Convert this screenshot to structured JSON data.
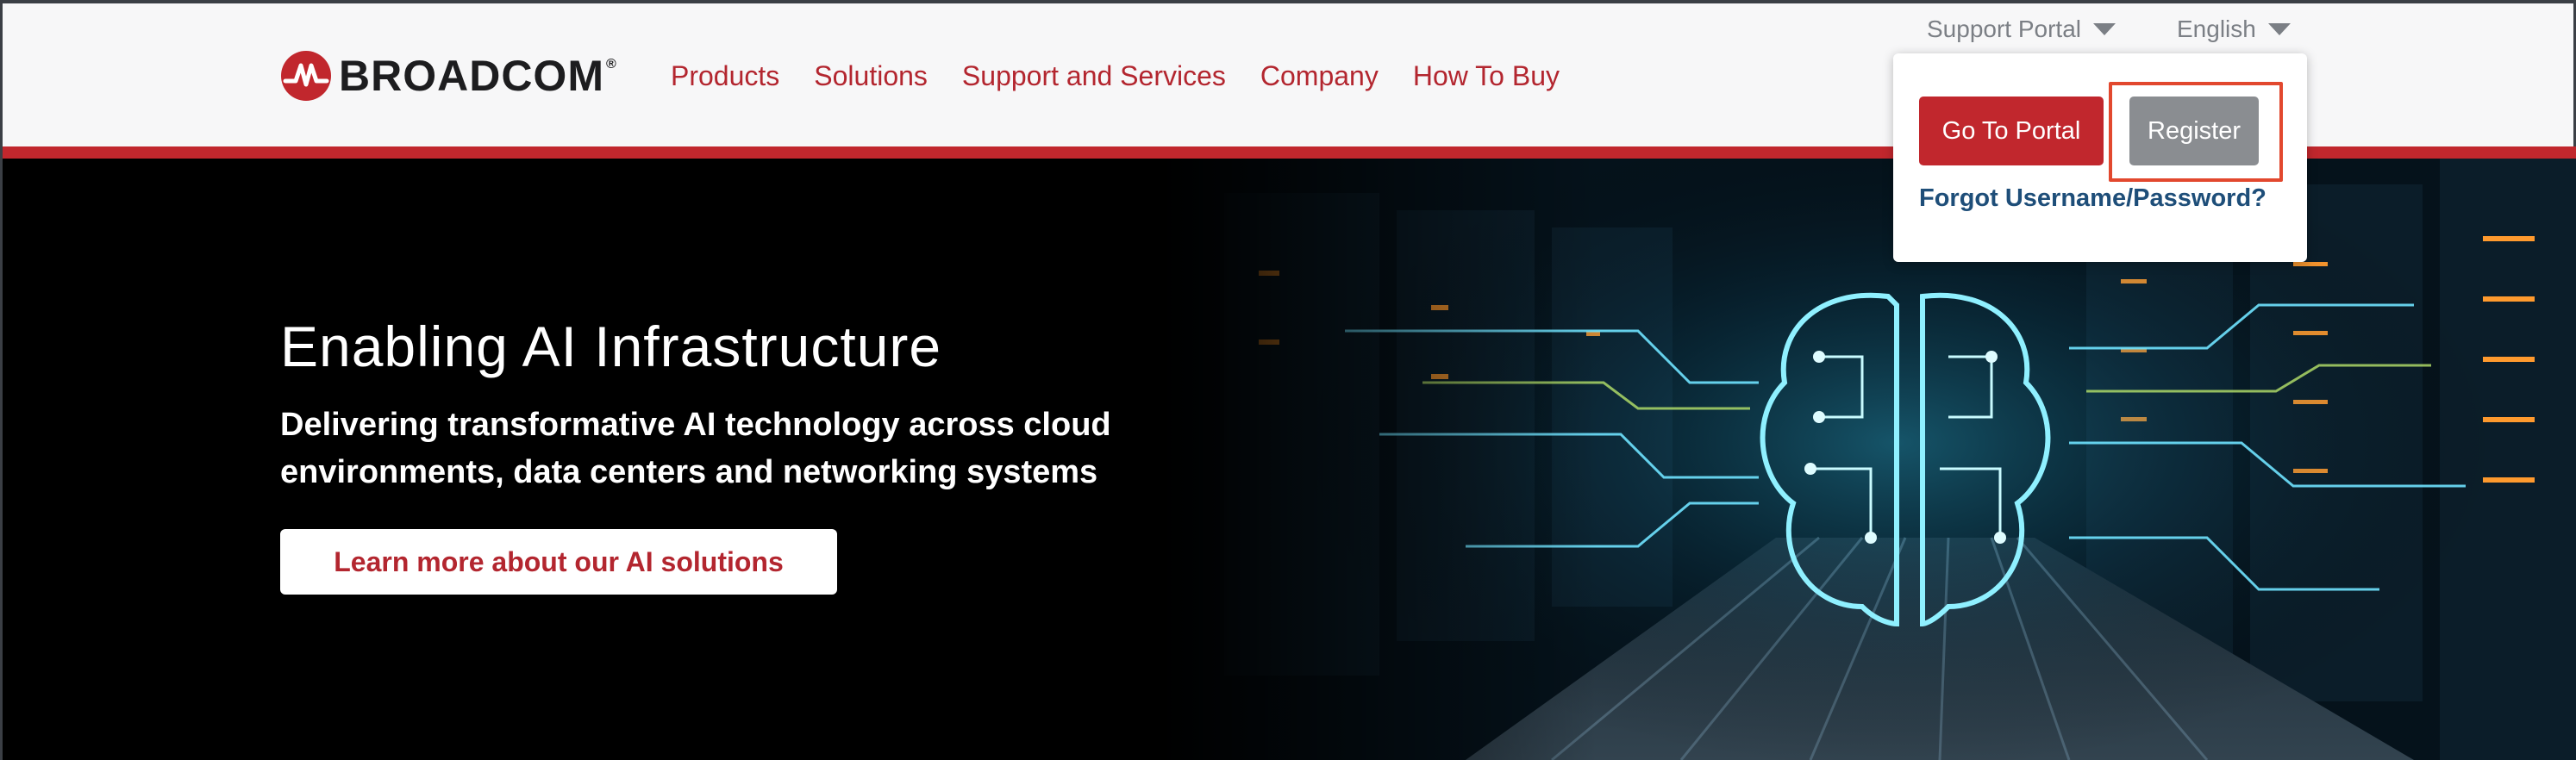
{
  "header": {
    "brand": "BROADCOM",
    "brand_mark": "®",
    "nav": [
      "Products",
      "Solutions",
      "Support and Services",
      "Company",
      "How To Buy"
    ],
    "support_portal_label": "Support Portal",
    "language_label": "English",
    "accent_color": "#c1272d"
  },
  "portal_dropdown": {
    "go_to_portal": "Go To Portal",
    "register": "Register",
    "forgot": "Forgot Username/Password?"
  },
  "hero": {
    "title": "Enabling AI Infrastructure",
    "subtitle_line1": "Delivering transformative AI technology across cloud",
    "subtitle_line2": "environments, data centers and networking systems",
    "cta": "Learn more about our AI solutions"
  },
  "icons": {
    "logo": "broadcom-logo-icon",
    "caret": "chevron-down-icon"
  }
}
